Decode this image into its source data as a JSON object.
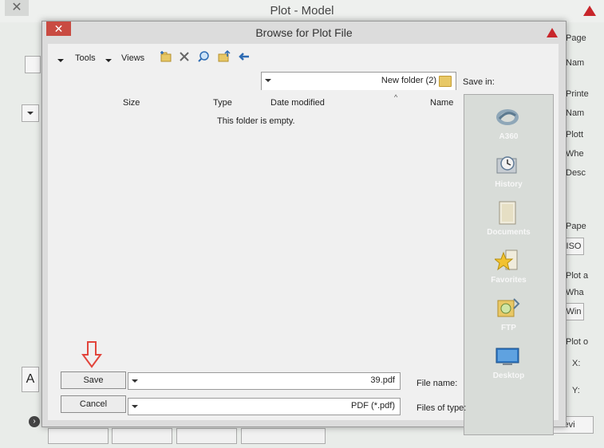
{
  "background_window": {
    "title": "Plot - Model",
    "close": "✕",
    "right_labels": [
      "Page",
      "Nam",
      "Printe",
      "Nam",
      "Plott",
      "Whe",
      "Desc",
      "Pape",
      "ISO",
      "Plot a",
      "Wha",
      "Win",
      "Plot o",
      "X:",
      "Y:",
      "Previ"
    ],
    "left_tab_letter": "A"
  },
  "dialog": {
    "title": "Browse for Plot File",
    "close": "✕",
    "toolbar": {
      "save_in_label": "Save in:",
      "save_in_value": "New folder (2)",
      "views_label": "Views",
      "tools_label": "Tools"
    },
    "columns": [
      "Name",
      "Date modified",
      "Type",
      "Size"
    ],
    "empty_message": "This folder is empty.",
    "places": [
      "A360",
      "History",
      "Documents",
      "Favorites",
      "FTP",
      "Desktop"
    ],
    "file_name_label": "File name:",
    "file_name_value": "39.pdf",
    "file_type_label": "Files of type:",
    "file_type_value": "PDF (*.pdf)",
    "save_button": "Save",
    "cancel_button": "Cancel",
    "annotation_arrow_color": "#e2453c"
  }
}
